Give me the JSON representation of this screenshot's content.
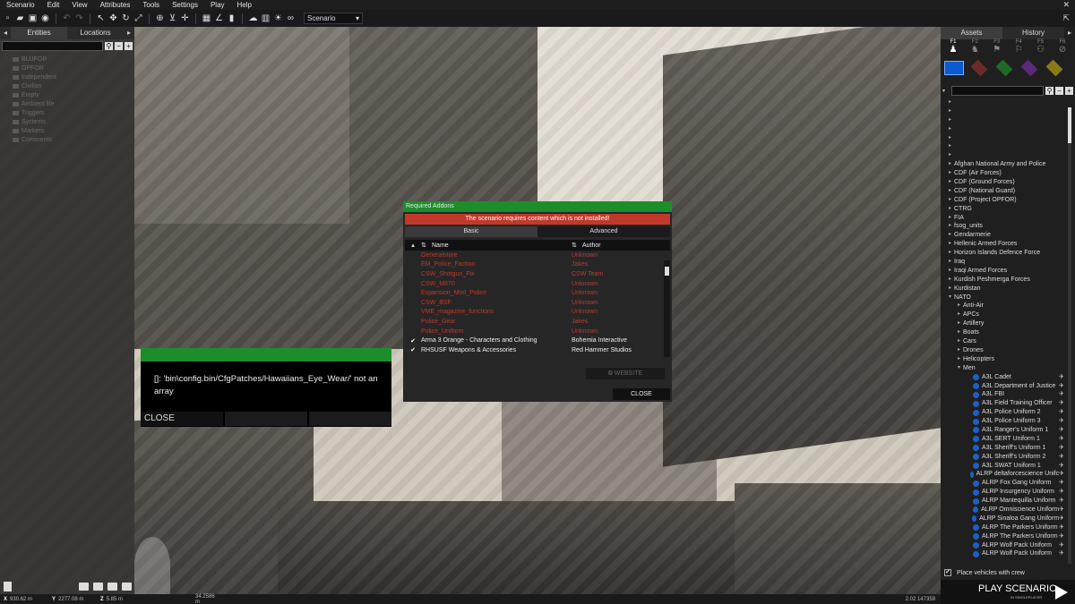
{
  "menubar": [
    "Scenario",
    "Edit",
    "View",
    "Attributes",
    "Tools",
    "Settings",
    "Play",
    "Help"
  ],
  "toolbar": {
    "mode_dropdown": "Scenario"
  },
  "left_panel": {
    "tabs": [
      "Entities",
      "Locations"
    ],
    "tree": [
      "BLUFOR",
      "OPFOR",
      "Independent",
      "Civilian",
      "Empty",
      "Ambient life",
      "Triggers",
      "Systems",
      "Markers",
      "Comments"
    ]
  },
  "right_panel": {
    "tabs": [
      "Assets",
      "History"
    ],
    "fkeys": [
      "F1",
      "F2",
      "F3",
      "F4",
      "F5",
      "F6"
    ],
    "side_colors": [
      "#0b5bd0",
      "#7a2a2a",
      "#1f6b25",
      "#5a2a7a",
      "#8a7a1a"
    ],
    "factions": [
      "Afghan National Army and Police",
      "CDF (Air Forces)",
      "CDF (Ground Forces)",
      "CDF (National Guard)",
      "CDF (Project OPFOR)",
      "CTRG",
      "FIA",
      "fsog_units",
      "Gendarmerie",
      "Hellenic Armed Forces",
      "Horizon Islands Defence Force",
      "Iraq",
      "Iraqi Armed Forces",
      "Kurdish Peshmerga Forces",
      "Kurdistan",
      "NATO"
    ],
    "nato_groups": [
      "Anti-Air",
      "APCs",
      "Artillery",
      "Boats",
      "Cars",
      "Drones",
      "Helicopters",
      "Men"
    ],
    "men": [
      "A3L Cadet",
      "A3L Department of Justice",
      "A3L FBI",
      "A3L Field Training Officer",
      "A3L Police Uniform 2",
      "A3L Police Uniform 3",
      "A3L Ranger's Uniform 1",
      "A3L SERT Uniform 1",
      "A3L Sheriff's Uniform 1",
      "A3L Sheriff's Uniform 2",
      "A3L SWAT Uniform 1",
      "ALRP deltaforcescience Unifc",
      "ALRP Fox Gang Uniform",
      "ALRP Insurgency Uniform",
      "ALRP Mantequilla Uniform",
      "ALRP Omniscience Uniform",
      "ALRP Sinaloa Gang Uniform",
      "ALRP The Parkers Uniform",
      "ALRP The Parkers Uniform",
      "ALRP Wolf Pack Uniform",
      "ALRP Wolf Pack Uniform"
    ],
    "place_vehicles_label": "Place vehicles with crew",
    "play_label": "PLAY SCENARIO",
    "play_sub": "IN SINGLEPLAYER"
  },
  "statusbar": {
    "x_label": "X",
    "x_value": "930.62 m",
    "y_label": "Y",
    "y_value": "2277.08 m",
    "z_label": "Z",
    "z_value": "5.85 m",
    "d_value": "34.2586 m",
    "right_value": "2.02  147359"
  },
  "addons_dialog": {
    "title": "Required Addons",
    "warning": "The scenario requires content which is not installed!",
    "tabs": [
      "Basic",
      "Advanced"
    ],
    "col_name": "Name",
    "col_author": "Author",
    "rows": [
      {
        "check": "",
        "name": "Generalstore",
        "author": "Unknown",
        "status": "missing"
      },
      {
        "check": "",
        "name": "EM_Police_Faction",
        "author": "Jakes",
        "status": "missing"
      },
      {
        "check": "",
        "name": "CSW_Shotgun_Fix",
        "author": "CSW Team",
        "status": "missing"
      },
      {
        "check": "",
        "name": "CSW_M870",
        "author": "Unknown",
        "status": "missing"
      },
      {
        "check": "",
        "name": "Expansion_Mod_Police",
        "author": "Unknown",
        "status": "missing"
      },
      {
        "check": "",
        "name": "CSW_BSF",
        "author": "Unknown",
        "status": "missing"
      },
      {
        "check": "",
        "name": "VME_magazine_functions",
        "author": "Unknown",
        "status": "missing"
      },
      {
        "check": "",
        "name": "Police_Gear",
        "author": "Jakes",
        "status": "missing"
      },
      {
        "check": "",
        "name": "Police_Uniform",
        "author": "Unknown",
        "status": "missing"
      },
      {
        "check": "✔",
        "name": "Arma 3 Orange - Characters and Clothing",
        "author": "Bohemia Interactive",
        "status": "ok"
      },
      {
        "check": "✔",
        "name": "RHSUSF Weapons & Accessories",
        "author": "Red Hammer Studios",
        "status": "ok"
      }
    ],
    "website_label": "WEBSITE",
    "close_label": "CLOSE"
  },
  "error_dialog": {
    "message": "[]: 'bin\\config.bin/CfgPatches/Hawaiians_Eye_Wear/' not an array",
    "close_label": "CLOSE"
  }
}
